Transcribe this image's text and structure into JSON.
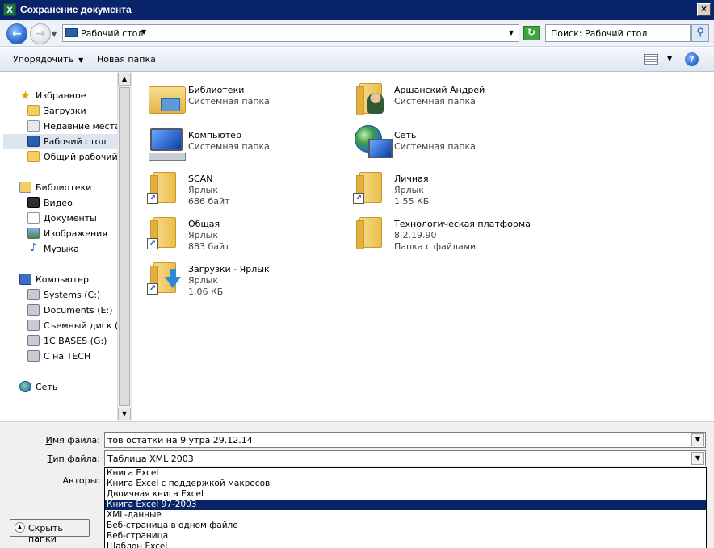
{
  "window": {
    "title": "Сохранение документа",
    "app_icon": "excel-icon",
    "close_label": "×"
  },
  "address": {
    "location": "Рабочий стол",
    "search_placeholder": "Поиск: Рабочий стол"
  },
  "toolbar": {
    "organize_label": "Упорядочить",
    "new_folder_label": "Новая папка",
    "help_label": "?"
  },
  "sidebar": {
    "favorites": {
      "label": "Избранное",
      "items": [
        {
          "label": "Загрузки",
          "icon": "downloads-folder-icon"
        },
        {
          "label": "Недавние места",
          "icon": "recent-places-icon"
        },
        {
          "label": "Рабочий стол",
          "icon": "desktop-icon",
          "selected": true
        },
        {
          "label": "Общий рабочий ст",
          "icon": "folder-icon"
        }
      ]
    },
    "libraries": {
      "label": "Библиотеки",
      "items": [
        {
          "label": "Видео",
          "icon": "video-icon"
        },
        {
          "label": "Документы",
          "icon": "documents-icon"
        },
        {
          "label": "Изображения",
          "icon": "pictures-icon"
        },
        {
          "label": "Музыка",
          "icon": "music-icon"
        }
      ]
    },
    "computer": {
      "label": "Компьютер",
      "items": [
        {
          "label": "Systems (C:)",
          "icon": "drive-icon"
        },
        {
          "label": "Documents (E:)",
          "icon": "drive-icon"
        },
        {
          "label": "Съемный диск (F:",
          "icon": "removable-drive-icon"
        },
        {
          "label": "1C BASES (G:)",
          "icon": "network-drive-icon"
        },
        {
          "label": "C на TECH",
          "icon": "network-drive-icon"
        }
      ]
    },
    "network": {
      "label": "Сеть"
    }
  },
  "files": [
    {
      "name": "Библиотеки",
      "type": "Системная папка",
      "size": "",
      "icon": "libraries-folder-icon"
    },
    {
      "name": "Аршанский Андрей",
      "type": "Системная папка",
      "size": "",
      "icon": "user-folder-icon"
    },
    {
      "name": "Компьютер",
      "type": "Системная папка",
      "size": "",
      "icon": "computer-icon"
    },
    {
      "name": "Сеть",
      "type": "Системная папка",
      "size": "",
      "icon": "network-icon"
    },
    {
      "name": "SCAN",
      "type": "Ярлык",
      "size": "686 байт",
      "icon": "folder-shortcut-icon"
    },
    {
      "name": "Личная",
      "type": "Ярлык",
      "size": "1,55 КБ",
      "icon": "folder-shortcut-icon"
    },
    {
      "name": "Общая",
      "type": "Ярлык",
      "size": "883 байт",
      "icon": "folder-shortcut-icon"
    },
    {
      "name": "Технологическая платформа",
      "type": "8.2.19.90",
      "size": "Папка с файлами",
      "icon": "folder-icon"
    },
    {
      "name": "Загрузки - Ярлык",
      "type": "Ярлык",
      "size": "1,06 КБ",
      "icon": "downloads-shortcut-icon"
    }
  ],
  "form": {
    "filename_label_u": "И",
    "filename_label_rest": "мя файла:",
    "filename_value": "тов остатки на 9 утра 29.12.14",
    "filetype_label_u": "Т",
    "filetype_label_rest": "ип файла:",
    "filetype_value": "Таблица XML 2003",
    "authors_label": "Авторы:",
    "hide_folders_label": "Скрыть папки"
  },
  "filetype_options": [
    "Книга Excel",
    "Книга Excel с поддержкой макросов",
    "Двоичная книга Excel",
    "Книга Excel 97-2003",
    "XML-данные",
    "Веб-страница в одном файле",
    "Веб-страница",
    "Шаблон Excel"
  ],
  "filetype_selected_index": 3
}
